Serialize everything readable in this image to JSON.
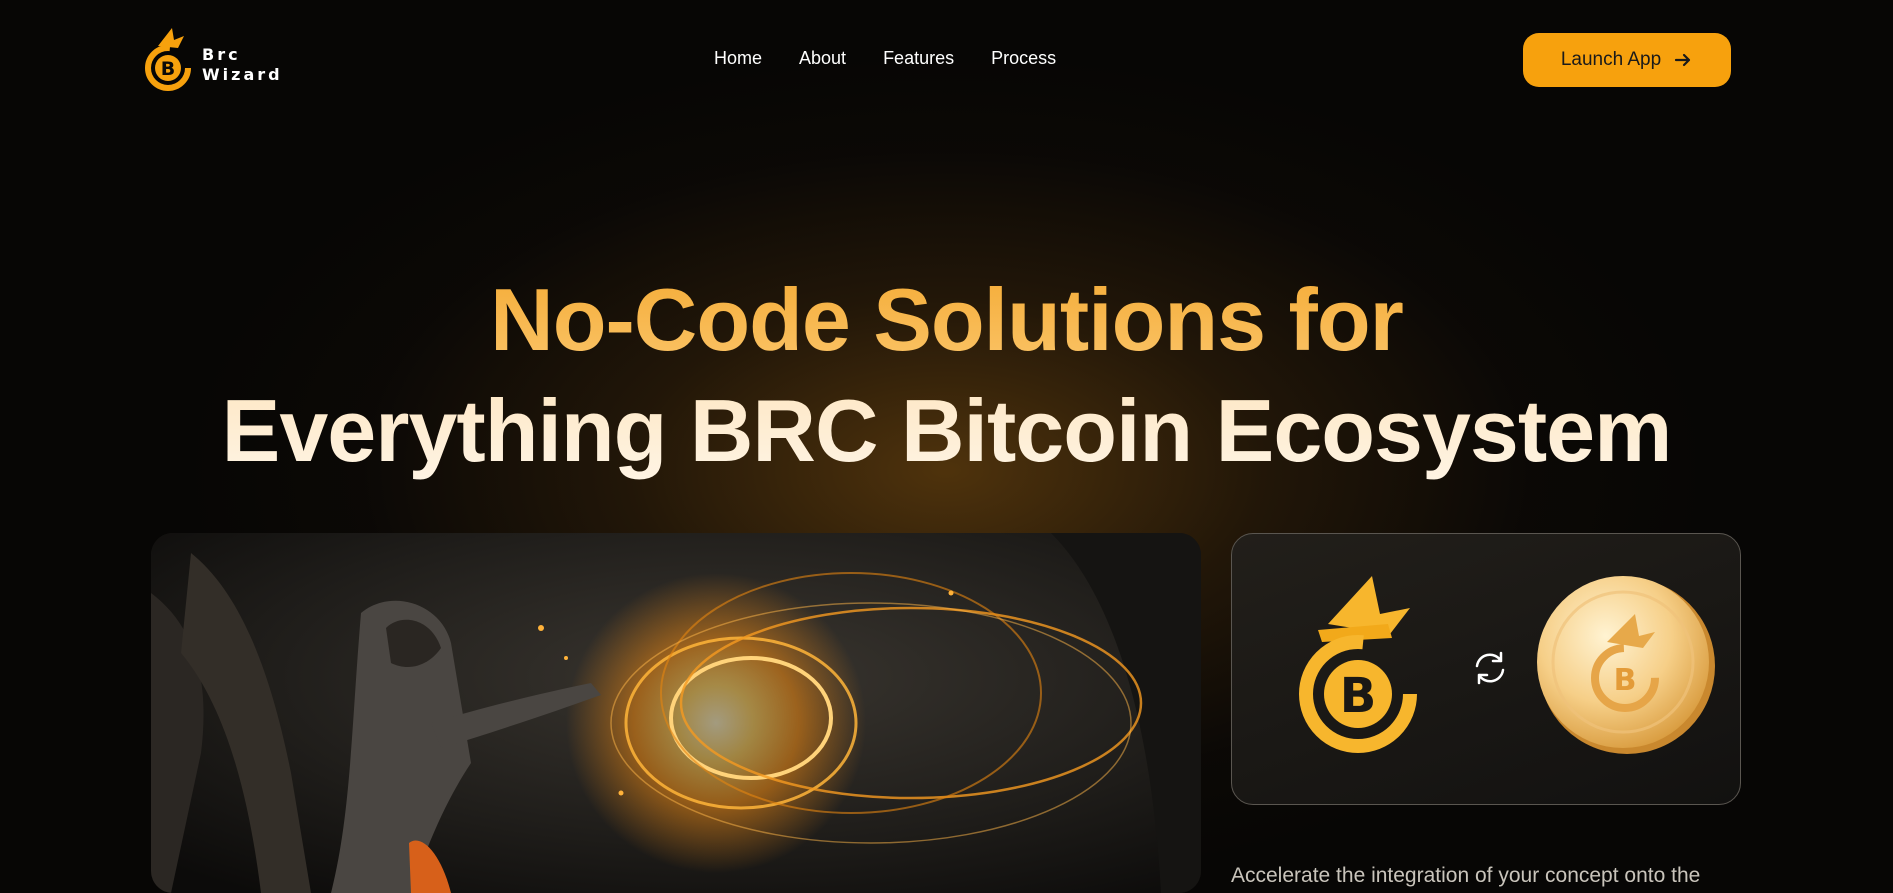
{
  "brand": {
    "line1": "Brc",
    "line2": "Wizard",
    "accent": "#f7a10d"
  },
  "nav": {
    "items": [
      {
        "label": "Home"
      },
      {
        "label": "About"
      },
      {
        "label": "Features"
      },
      {
        "label": "Process"
      }
    ],
    "cta_label": "Launch App",
    "cta_icon": "arrow-right-icon"
  },
  "hero": {
    "title_line1": "No-Code Solutions for",
    "title_line2": "Everything BRC Bitcoin Ecosystem",
    "image_desc_icon": "wizard-fire-portal-image",
    "swap_icon": "swap-arrows-icon",
    "description": "Accelerate the integration of your concept onto the"
  }
}
